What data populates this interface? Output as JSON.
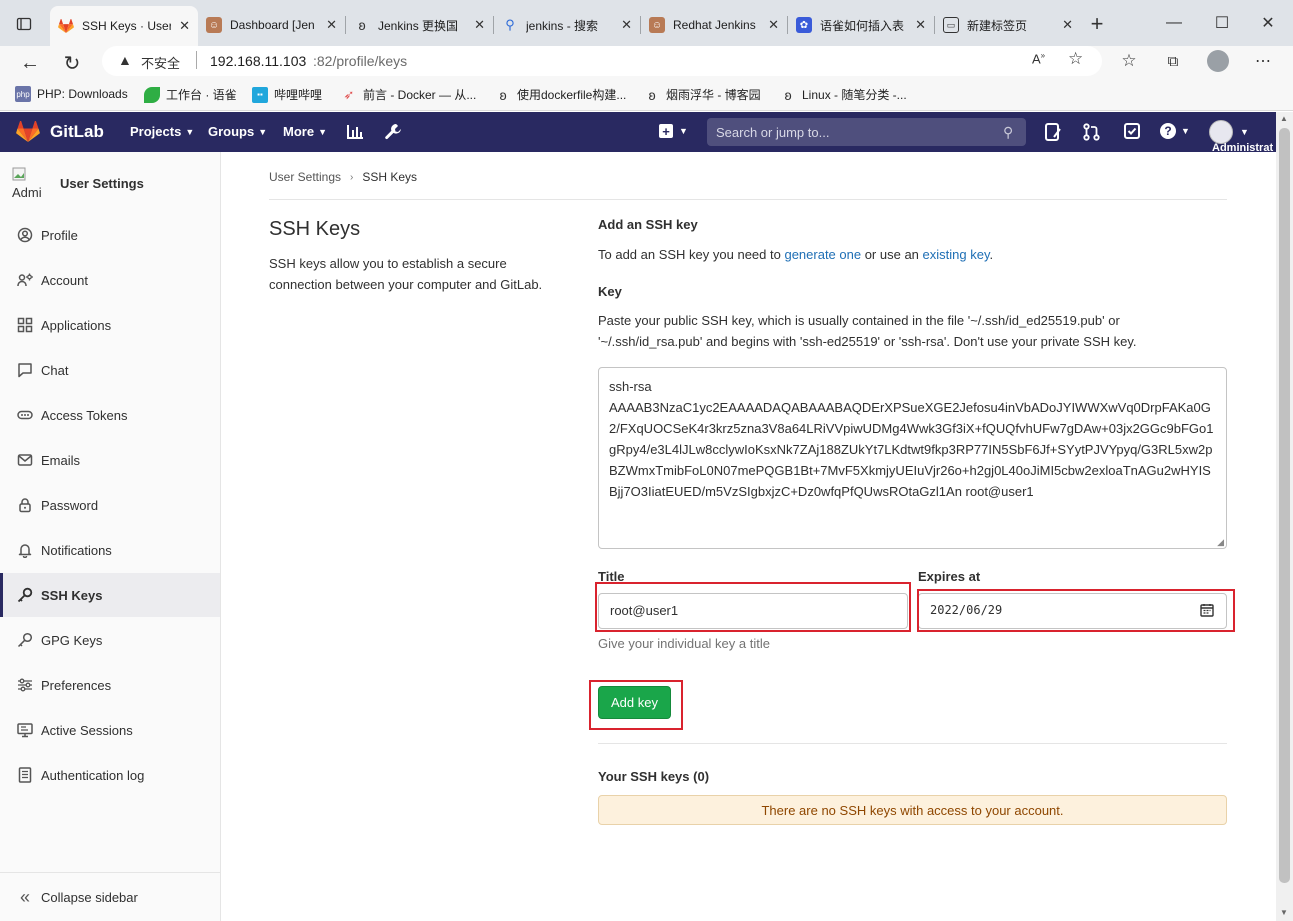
{
  "browser": {
    "tabs": [
      {
        "title": "SSH Keys · User",
        "active": true,
        "color": "#e24329"
      },
      {
        "title": "Dashboard [Jen",
        "color": "#b87a55"
      },
      {
        "title": "Jenkins 更换国",
        "color": "#333333"
      },
      {
        "title": "jenkins - 搜索",
        "color": "#2e6bd8"
      },
      {
        "title": "Redhat Jenkins",
        "color": "#b87a55"
      },
      {
        "title": "语雀如何插入表",
        "color": "#3a5bd9"
      },
      {
        "title": "新建标签页",
        "color": "#333333"
      }
    ],
    "security_label": "不安全",
    "url_host": "192.168.11.103",
    "url_rest": ":82/profile/keys",
    "bookmarks": [
      {
        "label": "PHP: Downloads",
        "icon": "php-icon",
        "color": "#6a74a8"
      },
      {
        "label": "工作台 · 语雀",
        "icon": "yuque-icon",
        "color": "#2fae44"
      },
      {
        "label": "哔哩哔哩",
        "icon": "bilibili-icon",
        "color": "#21a7dc"
      },
      {
        "label": "前言 - Docker — 从...",
        "icon": "rocket-icon",
        "color": "#e05050"
      },
      {
        "label": "使用dockerfile构建...",
        "icon": "cnblogs-icon",
        "color": "#444444"
      },
      {
        "label": "烟雨浮华 - 博客园",
        "icon": "cnblogs-icon",
        "color": "#444444"
      },
      {
        "label": "Linux - 随笔分类 -...",
        "icon": "cnblogs-icon",
        "color": "#444444"
      }
    ]
  },
  "gitlab": {
    "brand": "GitLab",
    "nav": [
      "Projects",
      "Groups",
      "More"
    ],
    "search_placeholder": "Search or jump to...",
    "user_label": "Administrat"
  },
  "sidebar": {
    "avatar_text": "Admi",
    "title": "User Settings",
    "items": [
      {
        "label": "Profile",
        "icon": "profile-icon"
      },
      {
        "label": "Account",
        "icon": "account-icon"
      },
      {
        "label": "Applications",
        "icon": "applications-icon"
      },
      {
        "label": "Chat",
        "icon": "chat-icon"
      },
      {
        "label": "Access Tokens",
        "icon": "token-icon"
      },
      {
        "label": "Emails",
        "icon": "email-icon"
      },
      {
        "label": "Password",
        "icon": "lock-icon"
      },
      {
        "label": "Notifications",
        "icon": "bell-icon"
      },
      {
        "label": "SSH Keys",
        "icon": "key-icon",
        "active": true
      },
      {
        "label": "GPG Keys",
        "icon": "key-icon"
      },
      {
        "label": "Preferences",
        "icon": "preferences-icon"
      },
      {
        "label": "Active Sessions",
        "icon": "monitor-icon"
      },
      {
        "label": "Authentication log",
        "icon": "log-icon"
      }
    ],
    "collapse_label": "Collapse sidebar"
  },
  "breadcrumb": {
    "parent": "User Settings",
    "current": "SSH Keys"
  },
  "left": {
    "heading": "SSH Keys",
    "description": "SSH keys allow you to establish a secure connection between your computer and GitLab."
  },
  "form": {
    "add_heading": "Add an SSH key",
    "intro_prefix": "To add an SSH key you need to ",
    "intro_link1": "generate one",
    "intro_mid": " or use an ",
    "intro_link2": "existing key",
    "intro_suffix": ".",
    "key_label": "Key",
    "key_help": "Paste your public SSH key, which is usually contained in the file '~/.ssh/id_ed25519.pub' or '~/.ssh/id_rsa.pub' and begins with 'ssh-ed25519' or 'ssh-rsa'. Don't use your private SSH key.",
    "key_value": "ssh-rsa\nAAAAB3NzaC1yc2EAAAADAQABAAABAQDErXPSueXGE2Jefosu4inVbADoJYIWWXwVq0DrpFAKa0G2/FXqUOCSeK4r3krz5zna3V8a64LRiVVpiwUDMg4Wwk3Gf3iX+fQUQfvhUFw7gDAw+03jx2GGc9bFGo1gRpy4/e3L4lJLw8cclywIoKsxNk7ZAj188ZUkYt7LKdtwt9fkp3RP77IN5SbF6Jf+SYytPJVYpyq/G3RL5xw2pBZWmxTmibFoL0N07mePQGB1Bt+7MvF5XkmjyUEIuVjr26o+h2gj0L40oJiMI5cbw2exloaTnAGu2wHYISBjj7O3IiatEUED/m5VzSIgbxjzC+Dz0wfqPfQUwsROtaGzl1An root@user1",
    "title_label": "Title",
    "title_value": "root@user1",
    "title_help": "Give your individual key a title",
    "expires_label": "Expires at",
    "expires_value": "2022/06/29",
    "add_button": "Add key",
    "your_keys_heading": "Your SSH keys (0)",
    "empty_message": "There are no SSH keys with access to your account."
  },
  "colors": {
    "header": "#292961",
    "accent": "#108548",
    "link": "#1f6fb5",
    "highlight": "#d9232e",
    "warning_bg": "#fdf1dd"
  }
}
